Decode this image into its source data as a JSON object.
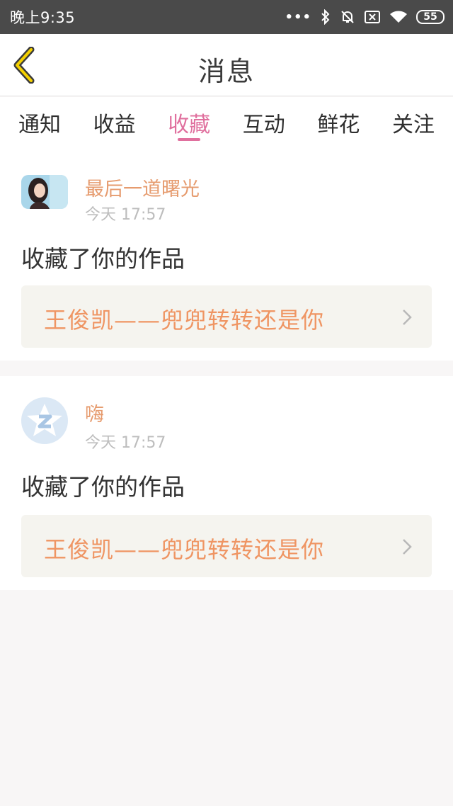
{
  "status_bar": {
    "time": "晚上9:35",
    "dots": "•••",
    "battery": "55"
  },
  "header": {
    "title": "消息"
  },
  "tabs": [
    {
      "label": "通知",
      "active": false
    },
    {
      "label": "收益",
      "active": false
    },
    {
      "label": "收藏",
      "active": true
    },
    {
      "label": "互动",
      "active": false
    },
    {
      "label": "鲜花",
      "active": false
    },
    {
      "label": "关注",
      "active": false
    }
  ],
  "messages": [
    {
      "user": "最后一道曙光",
      "time": "今天 17:57",
      "action": "收藏了你的作品",
      "work": "王俊凯——兜兜转转还是你"
    },
    {
      "user": "嗨",
      "time": "今天 17:57",
      "action": "收藏了你的作品",
      "work": "王俊凯——兜兜转转还是你"
    }
  ],
  "colors": {
    "accent": "#e0709e",
    "name": "#e69b6e",
    "work": "#ef9563",
    "status_bar": "#4a4a4a"
  }
}
